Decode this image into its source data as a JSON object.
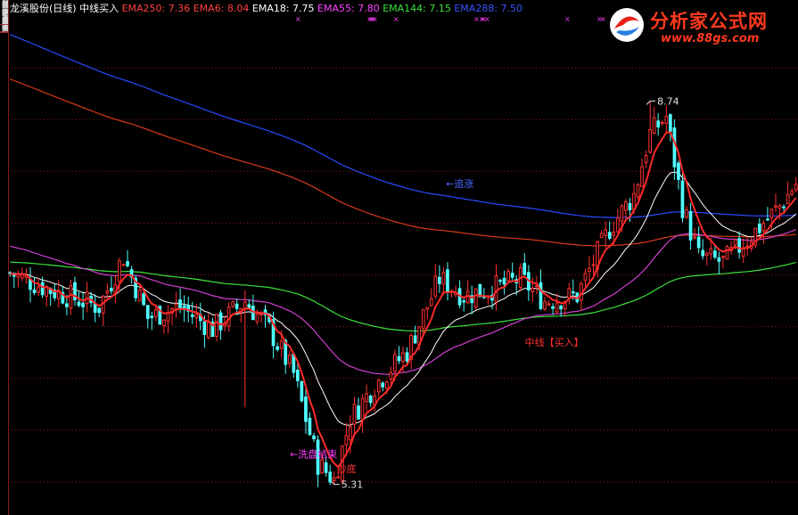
{
  "sidebar": {
    "tabs": [
      "分时走势",
      "技术分析",
      "基本资料",
      "财务透视",
      "分时图",
      "分价表",
      "F10资料",
      "F10深度",
      "操盘手",
      "分时成交"
    ]
  },
  "logo": {
    "name": "分析家公式网",
    "url": "www.88gs.com"
  },
  "chart_data": {
    "type": "candlestick",
    "title": "龙溪股份(日线) 中线买入",
    "indicators": [
      {
        "name": "EMA250",
        "label": "EMA250: 7.36",
        "value": 7.36,
        "color": "#ff4040"
      },
      {
        "name": "EMA6",
        "label": "EMA6: 8.04",
        "value": 8.04,
        "color": "#ff4040"
      },
      {
        "name": "EMA18",
        "label": "EMA18: 7.75",
        "value": 7.75,
        "color": "#ffffff"
      },
      {
        "name": "EMA55",
        "label": "EMA55: 7.80",
        "value": 7.8,
        "color": "#ff40ff"
      },
      {
        "name": "EMA144",
        "label": "EMA144: 7.15",
        "value": 7.15,
        "color": "#3ce23c"
      },
      {
        "name": "EMA288",
        "label": "EMA288: 7.50",
        "value": 7.5,
        "color": "#3a53ff"
      }
    ],
    "colors": {
      "up": "#ff3030",
      "down": "#50ffff",
      "ema6": "#ff2a2a",
      "ema18": "#ffffff",
      "ema55": "#d040d0",
      "ema144": "#3ce23c",
      "ema250": "#d83a1a",
      "ema288": "#2a4aff",
      "grid": "#8a1a1a"
    },
    "ylim": [
      5.1,
      9.5
    ],
    "annotations": [
      {
        "text": "8.74",
        "value": 8.74,
        "color": "#e0e0e0"
      },
      {
        "text": "5.31",
        "value": 5.31,
        "color": "#e0e0e0"
      },
      {
        "text": "←追涨",
        "color": "#4a6aff"
      },
      {
        "text": "中线【买入】",
        "color": "#ff3030"
      },
      {
        "text": "←洗盘结束",
        "color": "#ff40ff"
      },
      {
        "text": "抄底",
        "color": "#ff3030"
      }
    ]
  }
}
